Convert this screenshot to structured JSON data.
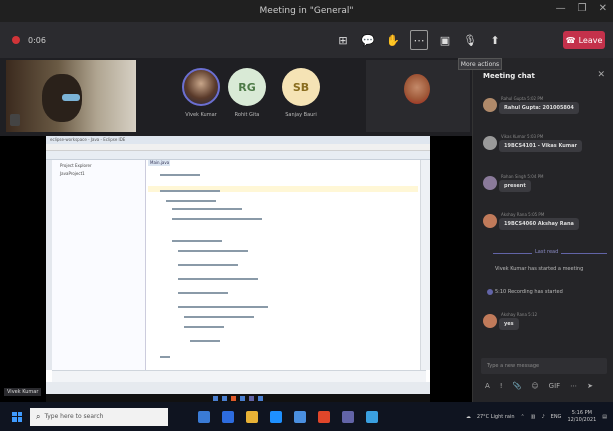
{
  "window": {
    "title": "Meeting in \"General\"",
    "controls": [
      "—",
      "❐",
      "✕"
    ]
  },
  "toolbar": {
    "timer": "0:06",
    "meeting_label": "",
    "tools": [
      {
        "name": "participants-icon",
        "glyph": "⊞"
      },
      {
        "name": "chat-icon",
        "glyph": "💬"
      },
      {
        "name": "raise-hand-icon",
        "glyph": "✋"
      },
      {
        "name": "more-actions-icon",
        "glyph": "⋯"
      },
      {
        "name": "camera-icon",
        "glyph": "▣"
      },
      {
        "name": "mic-icon",
        "glyph": "🎙"
      },
      {
        "name": "share-icon",
        "glyph": "⬆"
      }
    ],
    "leave_label": "Leave",
    "tooltip": "More actions"
  },
  "participants": [
    {
      "initials": "",
      "name": "Vivek Kumar",
      "style": "photo"
    },
    {
      "initials": "RG",
      "name": "Rohit Gita",
      "style": "rg"
    },
    {
      "initials": "SB",
      "name": "Sanjay Bauri",
      "style": "sb"
    }
  ],
  "shared_screen": {
    "ide_title": "eclipse-workspace - Java - Eclipse IDE",
    "tree_items": [
      "Project Explorer",
      "JavaProject1"
    ],
    "editor_tab": "Main.java",
    "presenter_label": "Vivek Kumar"
  },
  "chat": {
    "header": "Meeting chat",
    "messages": [
      {
        "author": "Rahul Gupta",
        "time": "5:02 PM",
        "text": "Rahul Gupta: 201005804"
      },
      {
        "author": "Vikas Kumar",
        "time": "5:03 PM",
        "text": "19BCS4101 - Vikas Kumar"
      },
      {
        "author": "Rohan Singh",
        "time": "5:04 PM",
        "text": "present"
      },
      {
        "author": "Akshay Rana",
        "time": "5:05 PM",
        "text": "19BCS4060 Akshay Rana"
      }
    ],
    "last_read": "Last read",
    "system_lines": [
      "Vivek Kumar has started a meeting",
      "5:10 Recording has started"
    ],
    "last_message": {
      "author": "Akshay Rana",
      "time": "5:12",
      "text": "yes"
    },
    "input_placeholder": "Type a new message",
    "tools": [
      "A",
      "!",
      "📎",
      "☺",
      "GIF",
      "⋯",
      "➤"
    ]
  },
  "taskbar": {
    "search_placeholder": "Type here to search",
    "tray_weather": "27°C Light rain",
    "tray_lang": "ENG",
    "time": "5:16 PM",
    "date": "12/10/2021"
  }
}
